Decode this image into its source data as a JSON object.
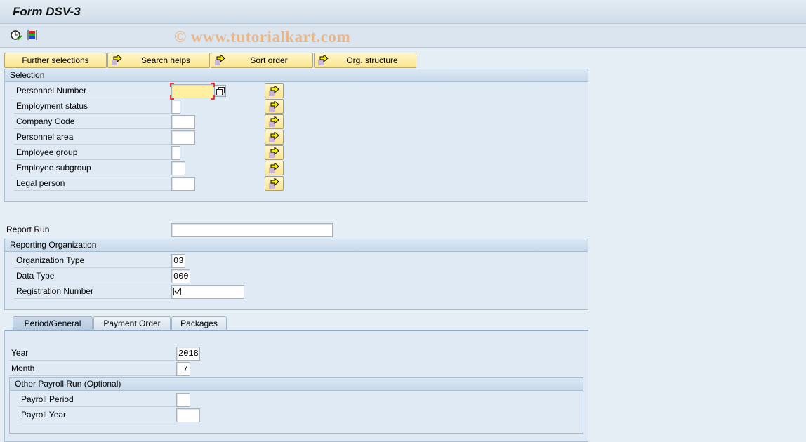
{
  "window": {
    "title": "Form DSV-3",
    "watermark": "© www.tutorialkart.com"
  },
  "toolbar": {
    "icons": [
      "execute-clock-icon",
      "variants-icon"
    ]
  },
  "buttons": [
    "Further selections",
    "Search helps",
    "Sort order",
    "Org. structure"
  ],
  "selection": {
    "title": "Selection",
    "rows": [
      {
        "label": "Personnel Number",
        "value": ""
      },
      {
        "label": "Employment status",
        "value": ""
      },
      {
        "label": "Company Code",
        "value": ""
      },
      {
        "label": "Personnel area",
        "value": ""
      },
      {
        "label": "Employee group",
        "value": ""
      },
      {
        "label": "Employee subgroup",
        "value": ""
      },
      {
        "label": "Legal person",
        "value": ""
      }
    ]
  },
  "report_run": {
    "label": "Report Run",
    "value": ""
  },
  "reporting_org": {
    "title": "Reporting Organization",
    "rows": [
      {
        "label": "Organization Type",
        "value": "03"
      },
      {
        "label": "Data Type",
        "value": "000"
      },
      {
        "label": "Registration Number",
        "value": "",
        "checked": true
      }
    ]
  },
  "tabs": [
    {
      "label": "Period/General",
      "active": true
    },
    {
      "label": "Payment Order"
    },
    {
      "label": "Packages"
    }
  ],
  "period": {
    "year": {
      "label": "Year",
      "value": "2018"
    },
    "month": {
      "label": "Month",
      "value": "7"
    },
    "other": {
      "title": "Other Payroll Run (Optional)",
      "period": {
        "label": "Payroll Period",
        "value": ""
      },
      "year": {
        "label": "Payroll Year",
        "value": ""
      }
    }
  },
  "colors": {
    "button": "#fbe58e",
    "active_field": "#fff0a0",
    "header": "#c8d9ea"
  }
}
